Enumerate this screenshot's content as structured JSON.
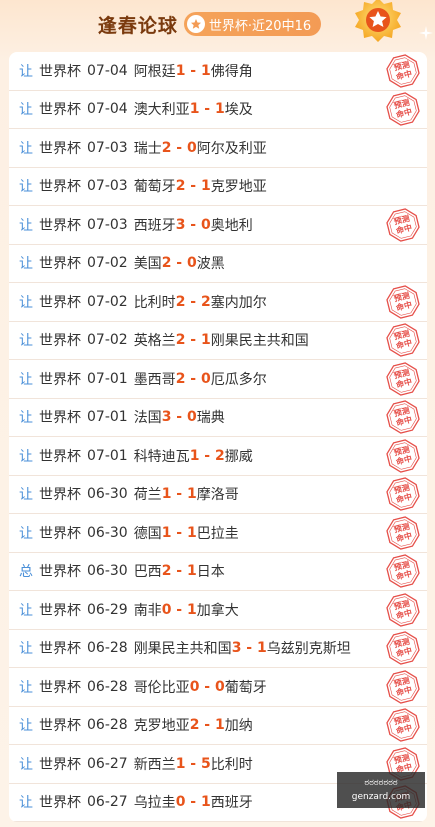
{
  "header": {
    "title": "逢春论球",
    "record": "世界杯·近20中16"
  },
  "stamp_text": [
    "预测",
    "命中"
  ],
  "colors": {
    "accent": "#e8541b",
    "type": "#4a8fd8",
    "stamp": "#e6504a",
    "badge": "#f39b55"
  },
  "rows": [
    {
      "type": "让",
      "league": "世界杯",
      "date": "07-04",
      "home": "阿根廷",
      "hs": "1",
      "as": "1",
      "away": "佛得角",
      "hit": true
    },
    {
      "type": "让",
      "league": "世界杯",
      "date": "07-04",
      "home": "澳大利亚",
      "hs": "1",
      "as": "1",
      "away": "埃及",
      "hit": true
    },
    {
      "type": "让",
      "league": "世界杯",
      "date": "07-03",
      "home": "瑞士",
      "hs": "2",
      "as": "0",
      "away": "阿尔及利亚",
      "hit": false
    },
    {
      "type": "让",
      "league": "世界杯",
      "date": "07-03",
      "home": "葡萄牙",
      "hs": "2",
      "as": "1",
      "away": "克罗地亚",
      "hit": false
    },
    {
      "type": "让",
      "league": "世界杯",
      "date": "07-03",
      "home": "西班牙",
      "hs": "3",
      "as": "0",
      "away": "奥地利",
      "hit": true
    },
    {
      "type": "让",
      "league": "世界杯",
      "date": "07-02",
      "home": "美国",
      "hs": "2",
      "as": "0",
      "away": "波黑",
      "hit": false
    },
    {
      "type": "让",
      "league": "世界杯",
      "date": "07-02",
      "home": "比利时",
      "hs": "2",
      "as": "2",
      "away": "塞内加尔",
      "hit": true
    },
    {
      "type": "让",
      "league": "世界杯",
      "date": "07-02",
      "home": "英格兰",
      "hs": "2",
      "as": "1",
      "away": "刚果民主共和国",
      "hit": true
    },
    {
      "type": "让",
      "league": "世界杯",
      "date": "07-01",
      "home": "墨西哥",
      "hs": "2",
      "as": "0",
      "away": "厄瓜多尔",
      "hit": true
    },
    {
      "type": "让",
      "league": "世界杯",
      "date": "07-01",
      "home": "法国",
      "hs": "3",
      "as": "0",
      "away": "瑞典",
      "hit": true
    },
    {
      "type": "让",
      "league": "世界杯",
      "date": "07-01",
      "home": "科特迪瓦",
      "hs": "1",
      "as": "2",
      "away": "挪威",
      "hit": true
    },
    {
      "type": "让",
      "league": "世界杯",
      "date": "06-30",
      "home": "荷兰",
      "hs": "1",
      "as": "1",
      "away": "摩洛哥",
      "hit": true
    },
    {
      "type": "让",
      "league": "世界杯",
      "date": "06-30",
      "home": "德国",
      "hs": "1",
      "as": "1",
      "away": "巴拉圭",
      "hit": true
    },
    {
      "type": "总",
      "league": "世界杯",
      "date": "06-30",
      "home": "巴西",
      "hs": "2",
      "as": "1",
      "away": "日本",
      "hit": true
    },
    {
      "type": "让",
      "league": "世界杯",
      "date": "06-29",
      "home": "南非",
      "hs": "0",
      "as": "1",
      "away": "加拿大",
      "hit": true
    },
    {
      "type": "让",
      "league": "世界杯",
      "date": "06-28",
      "home": "刚果民主共和国",
      "hs": "3",
      "as": "1",
      "away": "乌兹别克斯坦",
      "hit": true
    },
    {
      "type": "让",
      "league": "世界杯",
      "date": "06-28",
      "home": "哥伦比亚",
      "hs": "0",
      "as": "0",
      "away": "葡萄牙",
      "hit": true
    },
    {
      "type": "让",
      "league": "世界杯",
      "date": "06-28",
      "home": "克罗地亚",
      "hs": "2",
      "as": "1",
      "away": "加纳",
      "hit": true
    },
    {
      "type": "让",
      "league": "世界杯",
      "date": "06-27",
      "home": "新西兰",
      "hs": "1",
      "as": "5",
      "away": "比利时",
      "hit": true
    },
    {
      "type": "让",
      "league": "世界杯",
      "date": "06-27",
      "home": "乌拉圭",
      "hs": "0",
      "as": "1",
      "away": "西班牙",
      "hit": true
    }
  ],
  "watermark": {
    "line1": "ಠಠಠಠಠಠಠ",
    "line2": "genzard.com"
  }
}
